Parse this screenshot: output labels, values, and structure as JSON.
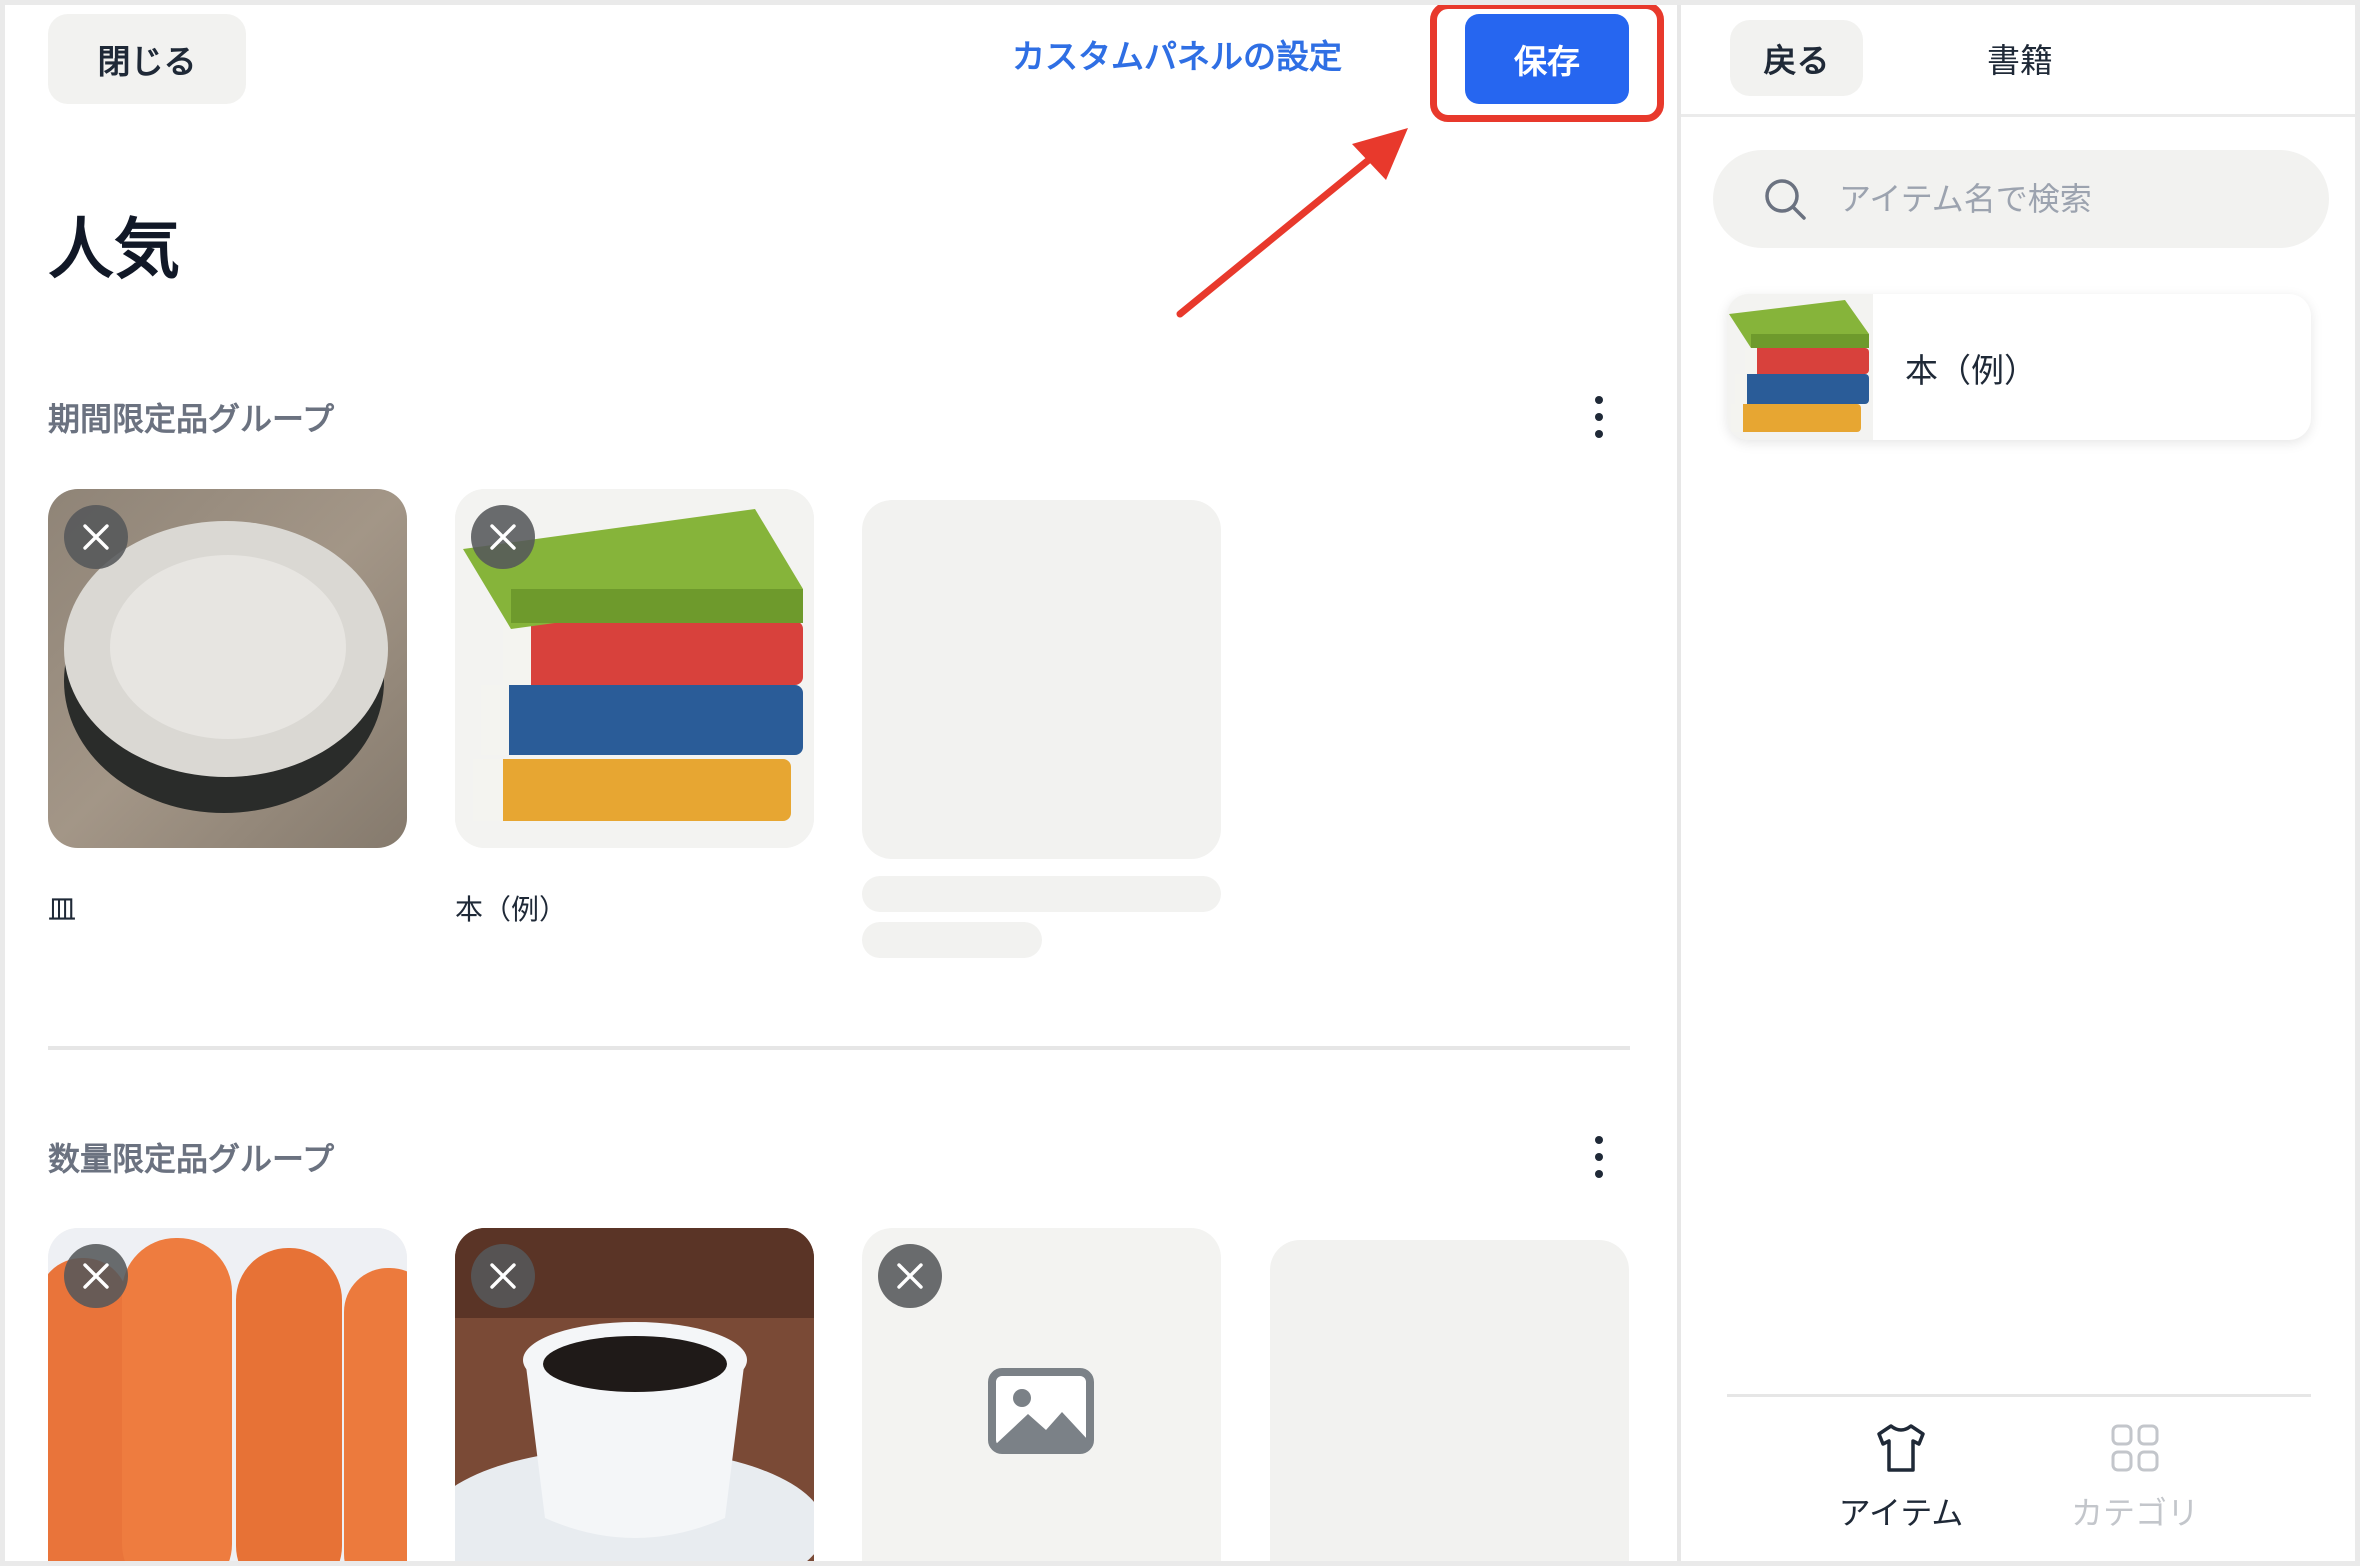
{
  "header": {
    "close_label": "閉じる",
    "settings_label": "カスタムパネルの設定",
    "save_label": "保存"
  },
  "page_title": "人気",
  "groups": [
    {
      "title": "期間限定品グループ",
      "items": [
        {
          "label": "皿",
          "image": "plate"
        },
        {
          "label": "本（例）",
          "image": "books"
        }
      ]
    },
    {
      "title": "数量限定品グループ",
      "items": [
        {
          "label": "",
          "image": "carrots"
        },
        {
          "label": "",
          "image": "coffee"
        },
        {
          "label": "",
          "image": "image-placeholder-icon"
        }
      ]
    }
  ],
  "side_panel": {
    "back_label": "戻る",
    "title": "書籍",
    "search": {
      "placeholder": "アイテム名で検索",
      "value": ""
    },
    "results": [
      {
        "label": "本（例）",
        "image": "books"
      }
    ],
    "bottom_tabs": [
      {
        "label": "アイテム",
        "icon": "shirt-icon",
        "active": true
      },
      {
        "label": "カテゴリ",
        "icon": "grid-icon",
        "active": false
      }
    ]
  },
  "colors": {
    "accent": "#2666f0",
    "link": "#2f6fe4",
    "highlight": "#e8392c",
    "inactive_tab": "#c3c6cb"
  }
}
